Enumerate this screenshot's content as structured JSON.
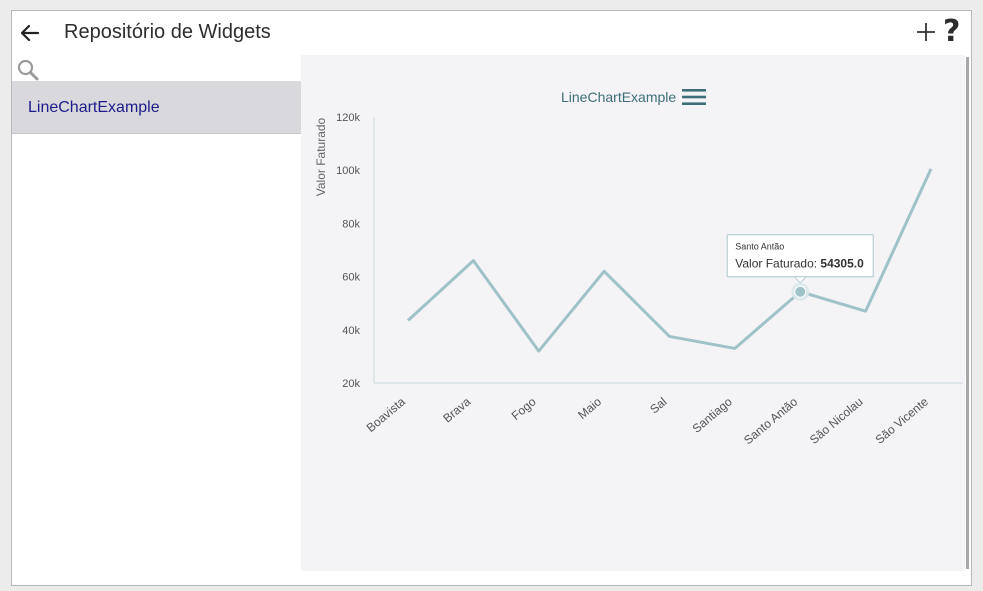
{
  "header": {
    "title": "Repositório de Widgets",
    "icons": [
      "arrow-left-icon",
      "plus-icon",
      "question-icon"
    ],
    "help_glyph": "?"
  },
  "search": {
    "icon": "search-icon"
  },
  "sidebar": {
    "items": [
      {
        "label": "LineChartExample",
        "selected": true
      }
    ]
  },
  "chart_data": {
    "type": "line",
    "title": "LineChartExample",
    "xlabel": "",
    "ylabel": "Valor Faturado",
    "categories": [
      "Boavista",
      "Brava",
      "Fogo",
      "Maio",
      "Sal",
      "Santiago",
      "Santo Antão",
      "São Nicolau",
      "São Vicente"
    ],
    "series": [
      {
        "name": "Valor Faturado",
        "values": [
          43500,
          66000,
          32000,
          62000,
          37500,
          33000,
          54305,
          47000,
          100500
        ]
      }
    ],
    "ylim": [
      20000,
      120000
    ],
    "yticks": [
      20000,
      40000,
      60000,
      80000,
      100000,
      120000
    ],
    "ytick_labels": [
      "20k",
      "40k",
      "60k",
      "80k",
      "100k",
      "120k"
    ],
    "grid": false,
    "line_color": "#9fc2c8",
    "tooltip": {
      "category": "Santo Antão",
      "label": "Valor Faturado",
      "value": "54305.0"
    }
  },
  "colors": {
    "accent": "#1c1c8a",
    "selected_bg": "#d9d8dc",
    "chart_bg": "#f4f3f6",
    "title_teal": "#3e6f78"
  }
}
